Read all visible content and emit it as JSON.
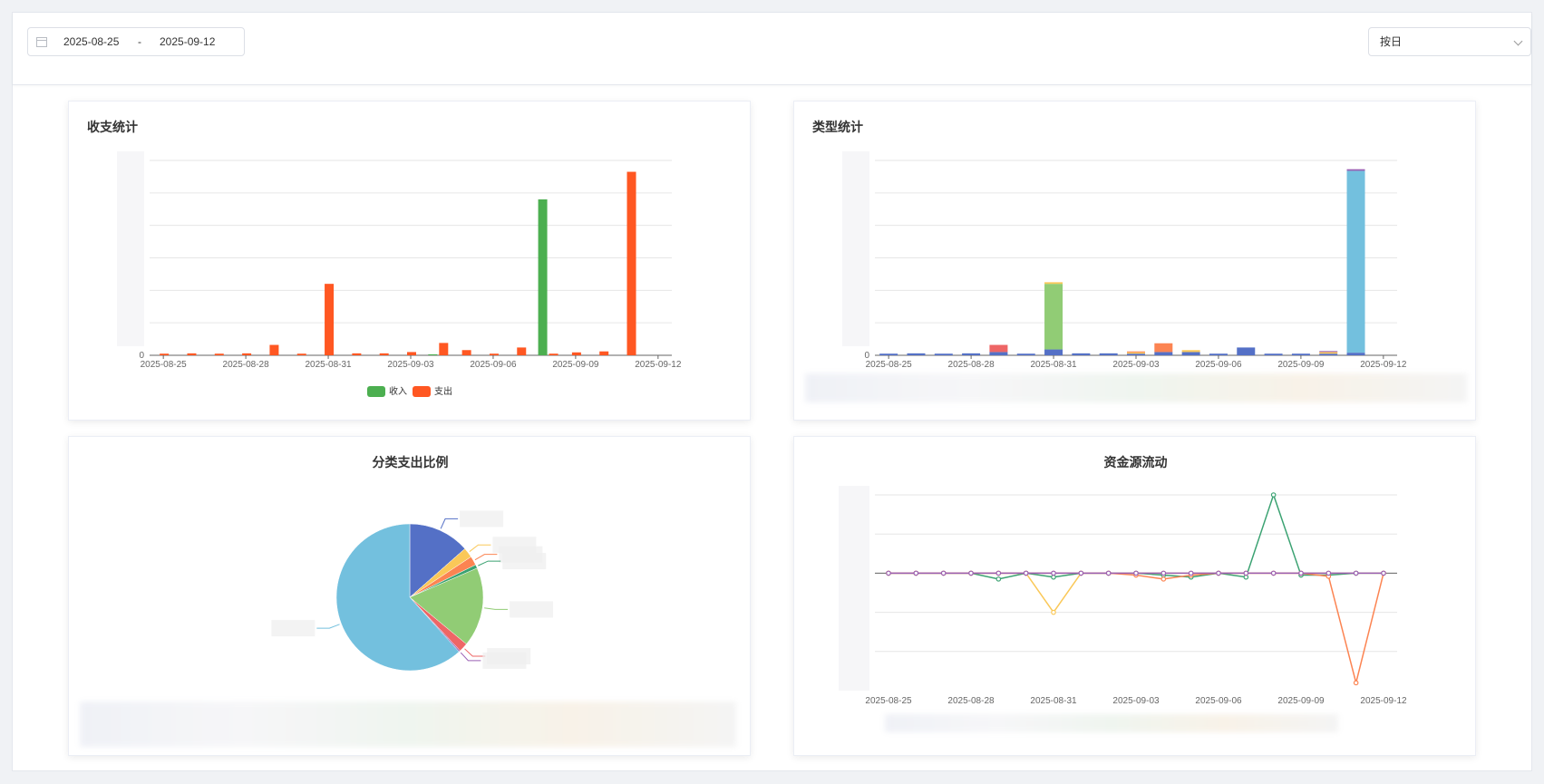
{
  "toolbar": {
    "start_date": "2025-08-25",
    "separator": "-",
    "end_date": "2025-09-12",
    "granularity": "按日"
  },
  "cards": {
    "income_expense_title": "收支统计",
    "type_stats_title": "类型统计",
    "category_ratio_title": "分类支出比例",
    "fund_flow_title": "资金源流动"
  },
  "colors": {
    "income": "#4caf50",
    "expense": "#ff5722",
    "blue": "#5470c6",
    "green": "#91cc75",
    "yellow": "#fac858",
    "red": "#ee6666",
    "cyan": "#73c0de",
    "teal": "#3ba272",
    "orange": "#fc8452",
    "purple": "#9a60b4"
  },
  "chart_data": [
    {
      "type": "bar",
      "title": "收支统计",
      "x_tick_labels": [
        "2025-08-25",
        "2025-08-28",
        "2025-08-31",
        "2025-09-03",
        "2025-09-06",
        "2025-09-09",
        "2025-09-12"
      ],
      "y_tick_labels": [
        "0"
      ],
      "categories": [
        "2025-08-25",
        "2025-08-26",
        "2025-08-27",
        "2025-08-28",
        "2025-08-29",
        "2025-08-30",
        "2025-08-31",
        "2025-09-01",
        "2025-09-02",
        "2025-09-03",
        "2025-09-04",
        "2025-09-05",
        "2025-09-06",
        "2025-09-07",
        "2025-09-08",
        "2025-09-09",
        "2025-09-10",
        "2025-09-11",
        "2025-09-12"
      ],
      "ylim": [
        0,
        6
      ],
      "series": [
        {
          "name": "收入",
          "values": [
            0,
            0,
            0,
            0,
            0,
            0,
            0,
            0,
            0,
            0,
            0.03,
            0,
            0,
            0,
            4.8,
            0,
            0,
            0,
            0
          ]
        },
        {
          "name": "支出",
          "values": [
            0.05,
            0.06,
            0.05,
            0.06,
            0.32,
            0.05,
            2.2,
            0.06,
            0.06,
            0.1,
            0.38,
            0.16,
            0.05,
            0.24,
            0.05,
            0.09,
            0.12,
            5.65,
            0
          ]
        }
      ],
      "legend": "bottom-center",
      "grid": true
    },
    {
      "type": "bar",
      "title": "类型统计",
      "x_tick_labels": [
        "2025-08-25",
        "2025-08-28",
        "2025-08-31",
        "2025-09-03",
        "2025-09-06",
        "2025-09-09",
        "2025-09-12"
      ],
      "y_tick_labels": [
        "0"
      ],
      "categories": [
        "2025-08-25",
        "2025-08-26",
        "2025-08-27",
        "2025-08-28",
        "2025-08-29",
        "2025-08-30",
        "2025-08-31",
        "2025-09-01",
        "2025-09-02",
        "2025-09-03",
        "2025-09-04",
        "2025-09-05",
        "2025-09-06",
        "2025-09-07",
        "2025-09-08",
        "2025-09-09",
        "2025-09-10",
        "2025-09-11",
        "2025-09-12"
      ],
      "ylim": [
        0,
        6
      ],
      "stacked": true,
      "series": [
        {
          "values": [
            0.05,
            0.06,
            0.05,
            0.06,
            0.1,
            0.05,
            0.18,
            0.06,
            0.06,
            0.05,
            0.1,
            0.1,
            0.05,
            0.24,
            0.05,
            0.05,
            0.05,
            0.08,
            0
          ]
        },
        {
          "values": [
            0,
            0,
            0,
            0,
            0,
            0,
            2.02,
            0,
            0,
            0,
            0,
            0,
            0,
            0,
            0,
            0,
            0,
            0,
            0
          ]
        },
        {
          "values": [
            0,
            0,
            0,
            0,
            0,
            0,
            0.05,
            0,
            0,
            0.04,
            0,
            0.06,
            0,
            0,
            0,
            0,
            0.05,
            0,
            0
          ]
        },
        {
          "values": [
            0,
            0,
            0,
            0,
            0.22,
            0,
            0,
            0,
            0,
            0,
            0,
            0,
            0,
            0,
            0,
            0,
            0,
            0,
            0
          ]
        },
        {
          "values": [
            0,
            0,
            0,
            0,
            0,
            0,
            0,
            0,
            0,
            0.03,
            0.27,
            0,
            0,
            0,
            0,
            0,
            0,
            0,
            0
          ]
        },
        {
          "values": [
            0,
            0,
            0,
            0,
            0,
            0,
            0,
            0,
            0,
            0,
            0,
            0,
            0,
            0,
            0,
            0,
            0,
            5.6,
            0
          ]
        },
        {
          "values": [
            0,
            0,
            0,
            0,
            0,
            0,
            0,
            0,
            0,
            0,
            0,
            0,
            0,
            0,
            0,
            0,
            0.03,
            0.05,
            0
          ]
        }
      ],
      "grid": true
    },
    {
      "type": "pie",
      "title": "分类支出比例",
      "series": [
        {
          "values": [
            13.5,
            2.2,
            2.0,
            0.8,
            17.5,
            2.0,
            0.3,
            61.7
          ]
        }
      ]
    },
    {
      "type": "line",
      "title": "资金源流动",
      "x_tick_labels": [
        "2025-08-25",
        "2025-08-28",
        "2025-08-31",
        "2025-09-03",
        "2025-09-06",
        "2025-09-09",
        "2025-09-12"
      ],
      "categories": [
        "2025-08-25",
        "2025-08-26",
        "2025-08-27",
        "2025-08-28",
        "2025-08-29",
        "2025-08-30",
        "2025-08-31",
        "2025-09-01",
        "2025-09-02",
        "2025-09-03",
        "2025-09-04",
        "2025-09-05",
        "2025-09-06",
        "2025-09-07",
        "2025-09-08",
        "2025-09-09",
        "2025-09-10",
        "2025-09-11",
        "2025-09-12"
      ],
      "ylim": [
        -3,
        2
      ],
      "series": [
        {
          "values": [
            0,
            0,
            0,
            0,
            -0.15,
            0,
            -0.1,
            0,
            0,
            0,
            -0.05,
            -0.1,
            0,
            -0.1,
            2.0,
            -0.05,
            -0.05,
            0,
            0
          ]
        },
        {
          "values": [
            0,
            0,
            0,
            0,
            0,
            0,
            -1.0,
            0,
            0,
            0,
            0,
            0,
            0,
            0,
            0,
            0,
            0,
            0,
            0
          ]
        },
        {
          "values": [
            0,
            0,
            0,
            0,
            0,
            0,
            0,
            0,
            0,
            -0.05,
            -0.15,
            -0.05,
            0,
            0,
            0,
            0,
            -0.08,
            -2.8,
            0
          ]
        },
        {
          "values": [
            0,
            0,
            0,
            0,
            0,
            0,
            0,
            0,
            0,
            0,
            0,
            0,
            0,
            0,
            0,
            0,
            0,
            0,
            0
          ]
        }
      ],
      "grid": true
    }
  ]
}
